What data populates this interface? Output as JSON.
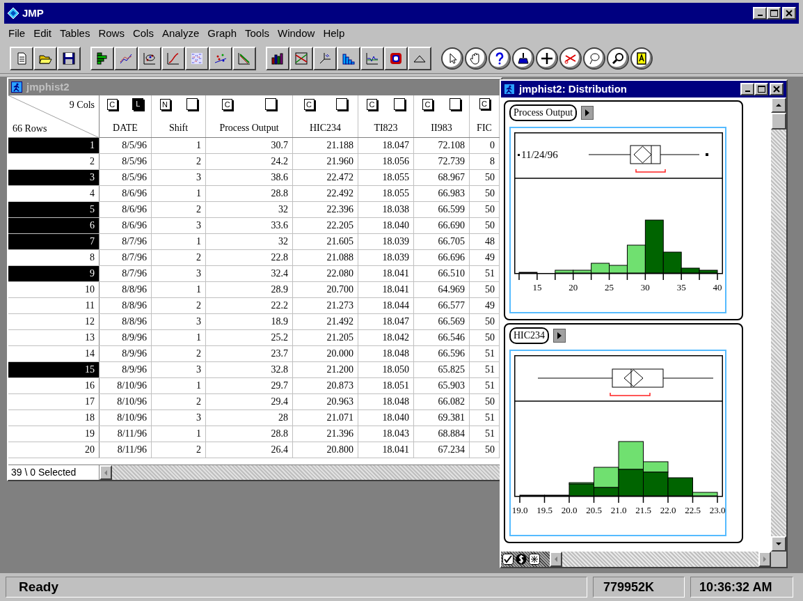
{
  "app": {
    "title": "JMP"
  },
  "menu": [
    {
      "label": "File"
    },
    {
      "label": "Edit"
    },
    {
      "label": "Tables"
    },
    {
      "label": "Rows"
    },
    {
      "label": "Cols"
    },
    {
      "label": "Analyze"
    },
    {
      "label": "Graph"
    },
    {
      "label": "Tools"
    },
    {
      "label": "Window"
    },
    {
      "label": "Help"
    }
  ],
  "data_table": {
    "title": "jmphist2",
    "active": false,
    "cols_count": "9 Cols",
    "rows_count": "66 Rows",
    "columns": [
      {
        "name": "DATE",
        "type": "C",
        "role_box": true,
        "role": "L"
      },
      {
        "name": "Shift",
        "type": "N",
        "role_box": true
      },
      {
        "name": "Process Output",
        "type": "C",
        "role_box": true
      },
      {
        "name": "HIC234",
        "type": "C",
        "role_box": true
      },
      {
        "name": "TI823",
        "type": "C",
        "role_box": true
      },
      {
        "name": "II983",
        "type": "C",
        "role_box": true
      },
      {
        "name": "FIC",
        "type": "C",
        "role_box": false
      }
    ],
    "rows": [
      {
        "number": "1",
        "selected": true,
        "cells": [
          "8/5/96",
          "1",
          "30.7",
          "21.188",
          "18.047",
          "72.108",
          "0"
        ]
      },
      {
        "number": "2",
        "selected": false,
        "cells": [
          "8/5/96",
          "2",
          "24.2",
          "21.960",
          "18.056",
          "72.739",
          "8"
        ]
      },
      {
        "number": "3",
        "selected": true,
        "cells": [
          "8/5/96",
          "3",
          "38.6",
          "22.472",
          "18.055",
          "68.967",
          "50"
        ]
      },
      {
        "number": "4",
        "selected": false,
        "cells": [
          "8/6/96",
          "1",
          "28.8",
          "22.492",
          "18.055",
          "66.983",
          "50"
        ]
      },
      {
        "number": "5",
        "selected": true,
        "cells": [
          "8/6/96",
          "2",
          "32",
          "22.396",
          "18.038",
          "66.599",
          "50"
        ]
      },
      {
        "number": "6",
        "selected": true,
        "cells": [
          "8/6/96",
          "3",
          "33.6",
          "22.205",
          "18.040",
          "66.690",
          "50"
        ]
      },
      {
        "number": "7",
        "selected": true,
        "cells": [
          "8/7/96",
          "1",
          "32",
          "21.605",
          "18.039",
          "66.705",
          "48"
        ]
      },
      {
        "number": "8",
        "selected": false,
        "cells": [
          "8/7/96",
          "2",
          "22.8",
          "21.088",
          "18.039",
          "66.696",
          "49"
        ]
      },
      {
        "number": "9",
        "selected": true,
        "cells": [
          "8/7/96",
          "3",
          "32.4",
          "22.080",
          "18.041",
          "66.510",
          "51"
        ]
      },
      {
        "number": "10",
        "selected": false,
        "cells": [
          "8/8/96",
          "1",
          "28.9",
          "20.700",
          "18.041",
          "64.969",
          "50"
        ]
      },
      {
        "number": "11",
        "selected": false,
        "cells": [
          "8/8/96",
          "2",
          "22.2",
          "21.273",
          "18.044",
          "66.577",
          "49"
        ]
      },
      {
        "number": "12",
        "selected": false,
        "cells": [
          "8/8/96",
          "3",
          "18.9",
          "21.492",
          "18.047",
          "66.569",
          "50"
        ]
      },
      {
        "number": "13",
        "selected": false,
        "cells": [
          "8/9/96",
          "1",
          "25.2",
          "21.205",
          "18.042",
          "66.546",
          "50"
        ]
      },
      {
        "number": "14",
        "selected": false,
        "cells": [
          "8/9/96",
          "2",
          "23.7",
          "20.000",
          "18.048",
          "66.596",
          "51"
        ]
      },
      {
        "number": "15",
        "selected": true,
        "cells": [
          "8/9/96",
          "3",
          "32.8",
          "21.200",
          "18.050",
          "65.825",
          "51"
        ]
      },
      {
        "number": "16",
        "selected": false,
        "cells": [
          "8/10/96",
          "1",
          "29.7",
          "20.873",
          "18.051",
          "65.903",
          "51"
        ]
      },
      {
        "number": "17",
        "selected": false,
        "cells": [
          "8/10/96",
          "2",
          "29.4",
          "20.963",
          "18.048",
          "66.082",
          "50"
        ]
      },
      {
        "number": "18",
        "selected": false,
        "cells": [
          "8/10/96",
          "3",
          "28",
          "21.071",
          "18.040",
          "69.381",
          "51"
        ]
      },
      {
        "number": "19",
        "selected": false,
        "cells": [
          "8/11/96",
          "1",
          "28.8",
          "21.396",
          "18.043",
          "68.884",
          "51"
        ]
      },
      {
        "number": "20",
        "selected": false,
        "cells": [
          "8/11/96",
          "2",
          "26.4",
          "20.800",
          "18.041",
          "67.234",
          "50"
        ]
      }
    ],
    "selection_status": "39 \\ 0 Selected"
  },
  "distribution": {
    "title": "jmphist2: Distribution",
    "active": true,
    "panels": [
      {
        "variable": "Process Output",
        "outlier_label": "11/24/96",
        "ticks": [
          "15",
          "20",
          "25",
          "30",
          "35",
          "40"
        ]
      },
      {
        "variable": "HIC234",
        "ticks": [
          "19.0",
          "19.5",
          "20.0",
          "20.5",
          "21.0",
          "21.5",
          "22.0",
          "22.5",
          "23.0"
        ]
      }
    ]
  },
  "status_bar": {
    "message": "Ready",
    "memory": "779952K",
    "time": "10:36:32 AM"
  }
}
